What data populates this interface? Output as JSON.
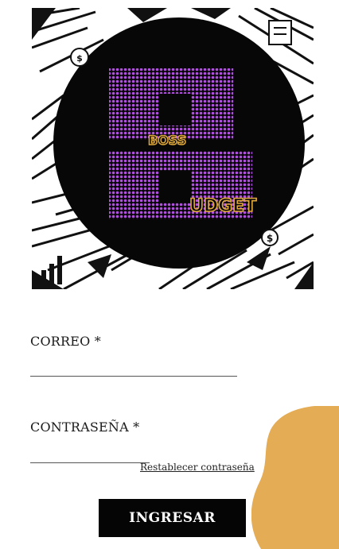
{
  "logo": {
    "line1": "BOSS",
    "line2": "UDGET",
    "accent": "#a545d8",
    "gold": "#e0a93b"
  },
  "form": {
    "email_label": "CORREO *",
    "email_value": "",
    "password_label": "CONTRASEÑA *",
    "password_value": "",
    "reset_link": "Restablecer contraseña",
    "submit_label": "INGRESAR"
  },
  "colors": {
    "blob": "#e4ac55",
    "button_bg": "#050505",
    "button_text": "#ffffff"
  }
}
